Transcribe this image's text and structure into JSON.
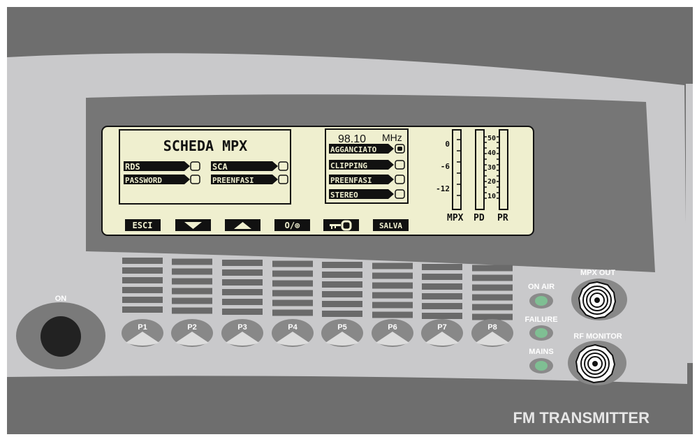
{
  "colors": {
    "frame_dark": "#6e6e6e",
    "panel_light": "#c9c9cb",
    "bezel": "#767676",
    "lcd_bg": "#efefcf",
    "led_green": "#7fbf93",
    "knob": "#222222"
  },
  "lcd": {
    "title": "SCHEDA MPX",
    "menu": [
      "RDS",
      "SCA",
      "PASSWORD",
      "PREENFASI"
    ],
    "frequency": "98.10",
    "freq_unit": "MHz",
    "status": [
      "AGGANCIATO",
      "CLIPPING",
      "PREENFASI",
      "STEREO"
    ],
    "status_on": [
      true,
      false,
      false,
      false
    ],
    "softkeys": {
      "exit": "ESCI",
      "down_icon": "triangle-down-icon",
      "up_icon": "triangle-up-icon",
      "toggle": "O/⊚",
      "key_icon": "key-icon",
      "save": "SALVA"
    },
    "meters": {
      "mpx_ticks": [
        "0",
        "-6",
        "-12"
      ],
      "pr_ticks": [
        "50",
        "40",
        "30",
        "20",
        "10"
      ],
      "mpx_label": "MPX",
      "pd_label": "PD",
      "pr_label": "PR"
    }
  },
  "buttons": [
    "P1",
    "P2",
    "P3",
    "P4",
    "P5",
    "P6",
    "P7",
    "P8"
  ],
  "power": {
    "label": "ON"
  },
  "leds": [
    {
      "label": "ON AIR"
    },
    {
      "label": "FAILURE"
    },
    {
      "label": "MAINS"
    }
  ],
  "connectors": {
    "mpx_out": "MPX OUT",
    "rf_monitor": "RF MONITOR"
  },
  "product": {
    "name": "FM TRANSMITTER"
  }
}
